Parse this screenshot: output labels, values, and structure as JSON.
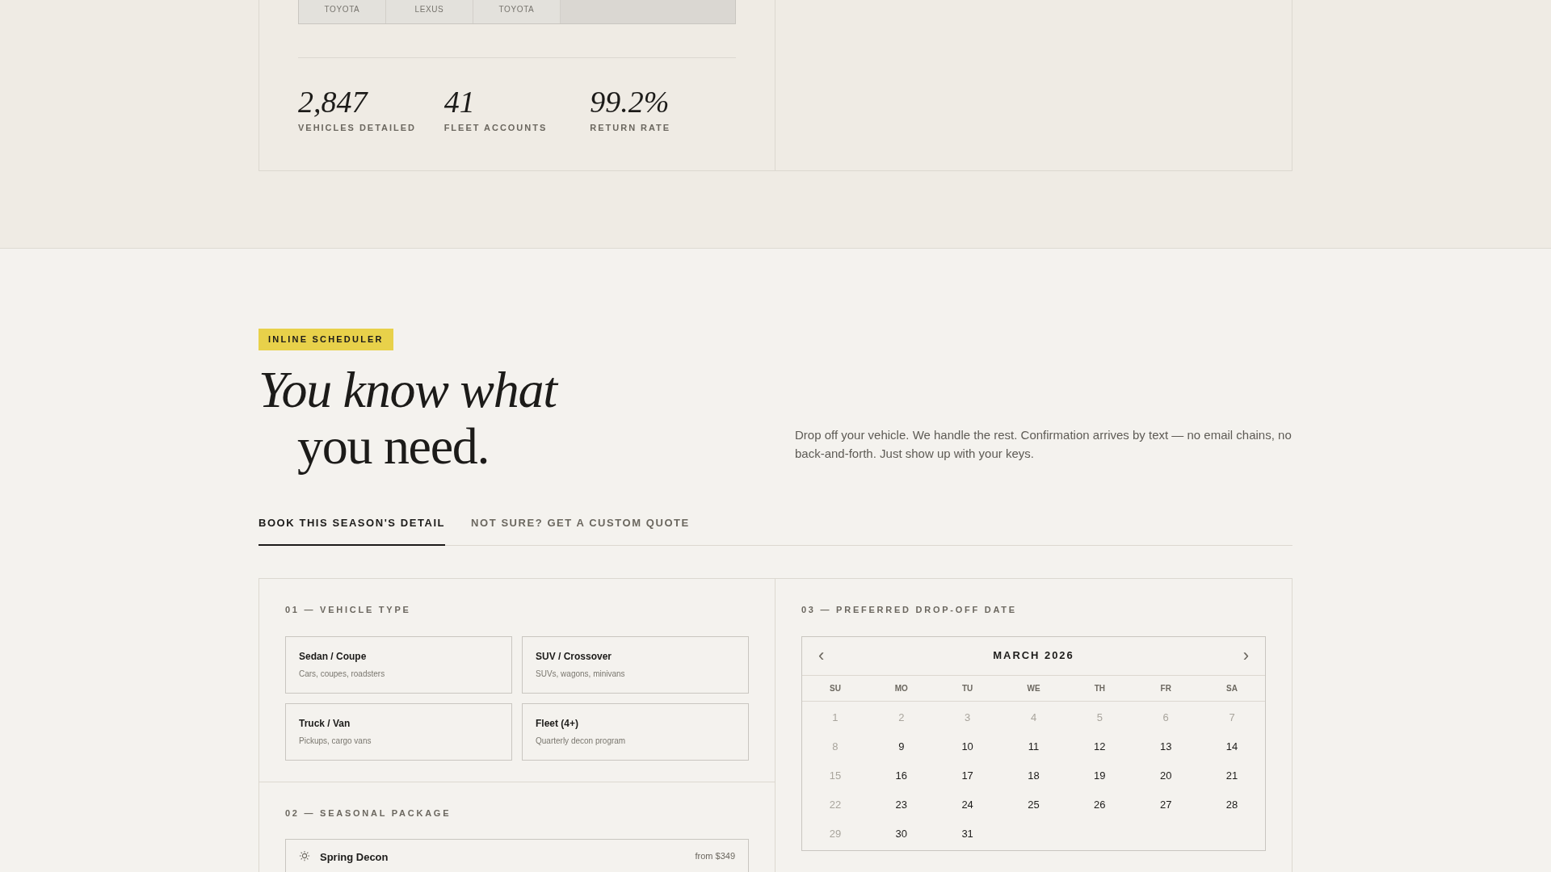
{
  "dealer_strip": [
    {
      "label": "TOYOTA"
    },
    {
      "label": "LEXUS"
    },
    {
      "label": "TOYOTA"
    }
  ],
  "stats": [
    {
      "value": "2,847",
      "label": "VEHICLES DETAILED"
    },
    {
      "value": "41",
      "label": "FLEET ACCOUNTS"
    },
    {
      "value": "99.2%",
      "label": "RETURN RATE"
    }
  ],
  "scheduler": {
    "badge": "INLINE SCHEDULER",
    "heading_line_1": "You know what",
    "heading_line_2": "you need.",
    "intro": "Drop off your vehicle. We handle the rest. Confirmation arrives by text — no email chains, no back-and-forth. Just show up with your keys."
  },
  "tabs": [
    {
      "label": "BOOK THIS SEASON'S DETAIL",
      "selected": true
    },
    {
      "label": "NOT SURE? GET A CUSTOM QUOTE",
      "selected": false
    }
  ],
  "vehicle_type": {
    "label": "01 — VEHICLE TYPE",
    "options": [
      {
        "title": "Sedan / Coupe",
        "subtitle": "Cars, coupes, roadsters",
        "selected": false
      },
      {
        "title": "SUV / Crossover",
        "subtitle": "SUVs, wagons, minivans",
        "selected": false
      },
      {
        "title": "Truck / Van",
        "subtitle": "Pickups, cargo vans",
        "selected": false
      },
      {
        "title": "Fleet (4+)",
        "subtitle": "Quarterly decon program",
        "selected": false
      }
    ]
  },
  "seasonal_package": {
    "label": "02 — SEASONAL PACKAGE",
    "options": [
      {
        "name": "Spring Decon",
        "price": "from $349",
        "selected": false
      }
    ]
  },
  "drop_off_date": {
    "label": "03 — PREFERRED DROP-OFF DATE",
    "month": "MARCH 2026",
    "prev": "‹",
    "next": "›",
    "weekdays": [
      "SU",
      "MO",
      "TU",
      "WE",
      "TH",
      "FR",
      "SA"
    ],
    "days": [
      {
        "day": "1",
        "disabled": true
      },
      {
        "day": "2",
        "disabled": true
      },
      {
        "day": "3",
        "disabled": true
      },
      {
        "day": "4",
        "disabled": true
      },
      {
        "day": "5",
        "disabled": true
      },
      {
        "day": "6",
        "disabled": true
      },
      {
        "day": "7",
        "disabled": true
      },
      {
        "day": "8",
        "disabled": true
      },
      {
        "day": "9",
        "disabled": false
      },
      {
        "day": "10",
        "disabled": false
      },
      {
        "day": "11",
        "disabled": false
      },
      {
        "day": "12",
        "disabled": false
      },
      {
        "day": "13",
        "disabled": false
      },
      {
        "day": "14",
        "disabled": false
      },
      {
        "day": "15",
        "disabled": true
      },
      {
        "day": "16",
        "disabled": false
      },
      {
        "day": "17",
        "disabled": false
      },
      {
        "day": "18",
        "disabled": false
      },
      {
        "day": "19",
        "disabled": false
      },
      {
        "day": "20",
        "disabled": false
      },
      {
        "day": "21",
        "disabled": false
      },
      {
        "day": "22",
        "disabled": true
      },
      {
        "day": "23",
        "disabled": false
      },
      {
        "day": "24",
        "disabled": false
      },
      {
        "day": "25",
        "disabled": false
      },
      {
        "day": "26",
        "disabled": false
      },
      {
        "day": "27",
        "disabled": false
      },
      {
        "day": "28",
        "disabled": false
      },
      {
        "day": "29",
        "disabled": true
      },
      {
        "day": "30",
        "disabled": false
      },
      {
        "day": "31",
        "disabled": false
      }
    ]
  }
}
